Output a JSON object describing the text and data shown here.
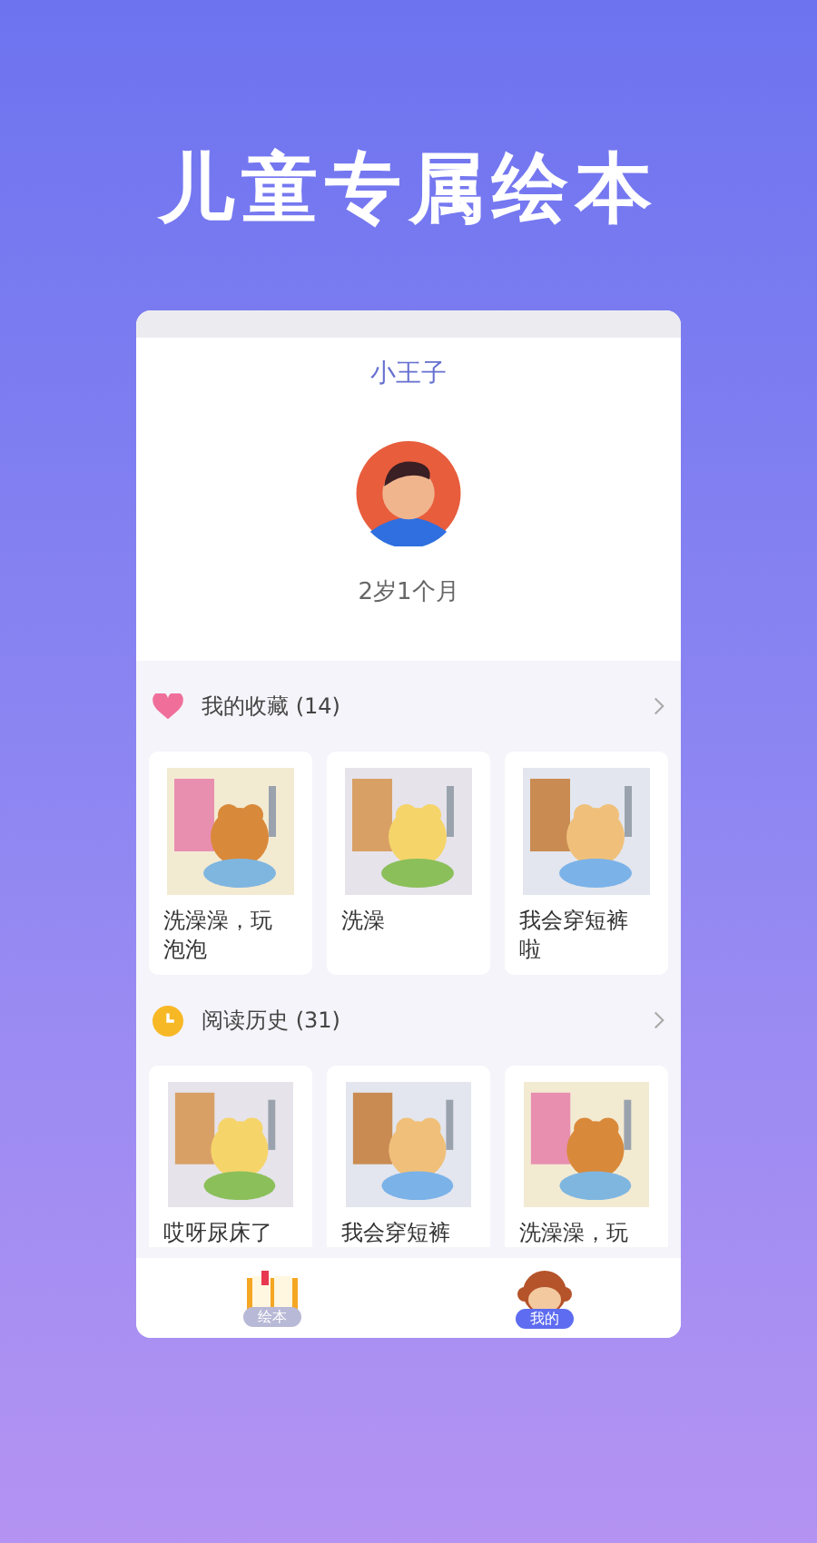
{
  "headline": "儿童专属绘本",
  "profile": {
    "name": "小王子",
    "age": "2岁1个月"
  },
  "sections": [
    {
      "kind": "favorites",
      "title": "我的收藏 (14)",
      "books": [
        {
          "title": "洗澡澡，玩泡泡"
        },
        {
          "title": "洗澡"
        },
        {
          "title": "我会穿短裤啦"
        }
      ]
    },
    {
      "kind": "history",
      "title": "阅读历史 (31)",
      "books": [
        {
          "title": "哎呀尿床了"
        },
        {
          "title": "我会穿短裤"
        },
        {
          "title": "洗澡澡，玩"
        }
      ]
    }
  ],
  "tabs": [
    {
      "label": "绘本",
      "kind": "book",
      "selected": false
    },
    {
      "label": "我的",
      "kind": "monkey",
      "selected": true
    }
  ]
}
